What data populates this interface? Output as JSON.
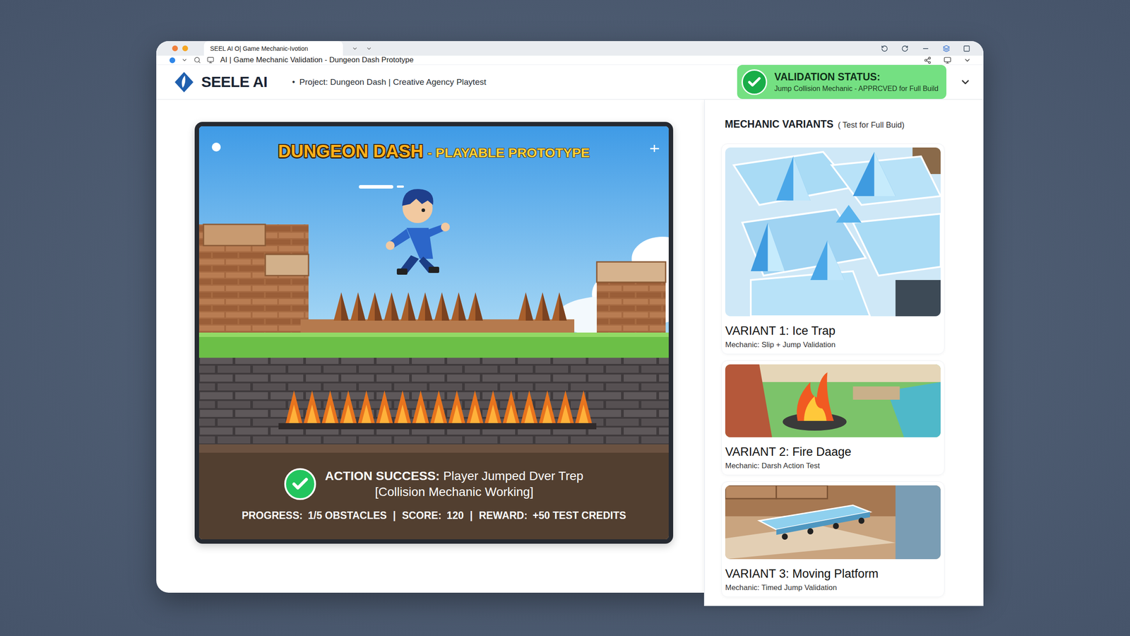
{
  "window": {
    "tab_title": "SEEL AI O| Game Mechanic-Ivotion",
    "address": "AI | Game Mechanic Validation - Dungeon Dash Prototype"
  },
  "header": {
    "logo": "SEELE AI",
    "bullet": "•",
    "project": "Project: Dungeon Dash | Creative Agency Playtest"
  },
  "validation": {
    "label": "VALIDATION STATUS:",
    "detail": "Jump Collision Mechanic - APPRCVED for Full Build",
    "approved": true
  },
  "game": {
    "title": "DUNGEON DASH",
    "subtitle": "- PLAYABLE PROTOTYPE",
    "result": {
      "label": "ACTION SUCCESS:",
      "message": "Player Jumped Dver Trep",
      "detail": "[Collision Mechanic Working]",
      "success": true
    },
    "separator": "|",
    "stats": [
      {
        "label": "PROGRESS:",
        "value": "1/5 OBSTACLES"
      },
      {
        "label": "SCORE:",
        "value": "120"
      },
      {
        "label": "REWARD:",
        "value": "+50 TEST CREDITS"
      }
    ]
  },
  "variants": {
    "title": "MECHANIC VARIANTS",
    "note": "( Test for Full Buid)",
    "items": [
      {
        "title": "VARIANT 1: Ice Trap",
        "mechanic": "Mechanic: Slip + Jump Validation",
        "kind": "ice"
      },
      {
        "title": "VARIANT 2: Fire Daage",
        "mechanic": "Mechanic: Darsh Action Test",
        "kind": "fire"
      },
      {
        "title": "VARIANT 3: Moving Platform",
        "mechanic": "Mechanic: Timed Jump Validation",
        "kind": "platform"
      }
    ]
  }
}
